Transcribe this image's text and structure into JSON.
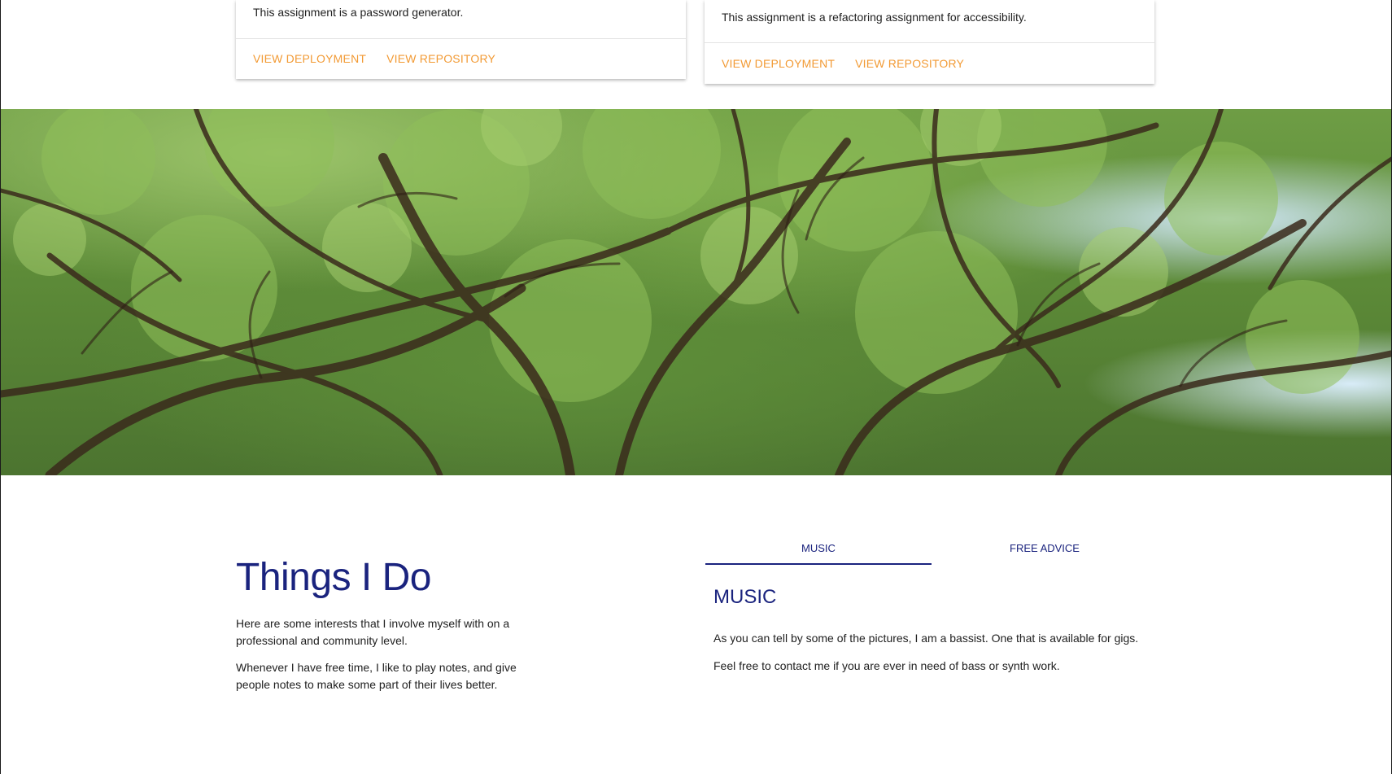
{
  "projects": [
    {
      "description": "This assignment is a password generator.",
      "deployment_label": "VIEW DEPLOYMENT",
      "repository_label": "VIEW REPOSITORY"
    },
    {
      "description": "This assignment is a refactoring assignment for accessibility.",
      "deployment_label": "VIEW DEPLOYMENT",
      "repository_label": "VIEW REPOSITORY"
    }
  ],
  "banner": {
    "image": "tree-canopy-photo"
  },
  "things": {
    "title": "Things I Do",
    "paragraphs": [
      "Here are some interests that I involve myself with on a professional and community level.",
      "Whenever I have free time, I like to play notes, and give people notes to make some part of their lives better."
    ]
  },
  "tabs": {
    "items": [
      {
        "label": "MUSIC",
        "active": true
      },
      {
        "label": "FREE ADVICE",
        "active": false
      }
    ],
    "panel": {
      "heading": "MUSIC",
      "paragraphs": [
        "As you can tell by some of the pictures, I am a bassist. One that is available for gigs.",
        "Feel free to contact me if you are ever in need of bass or synth work."
      ]
    }
  },
  "colors": {
    "accent_link": "#f29a34",
    "heading": "#1a237e",
    "text": "#212121"
  }
}
